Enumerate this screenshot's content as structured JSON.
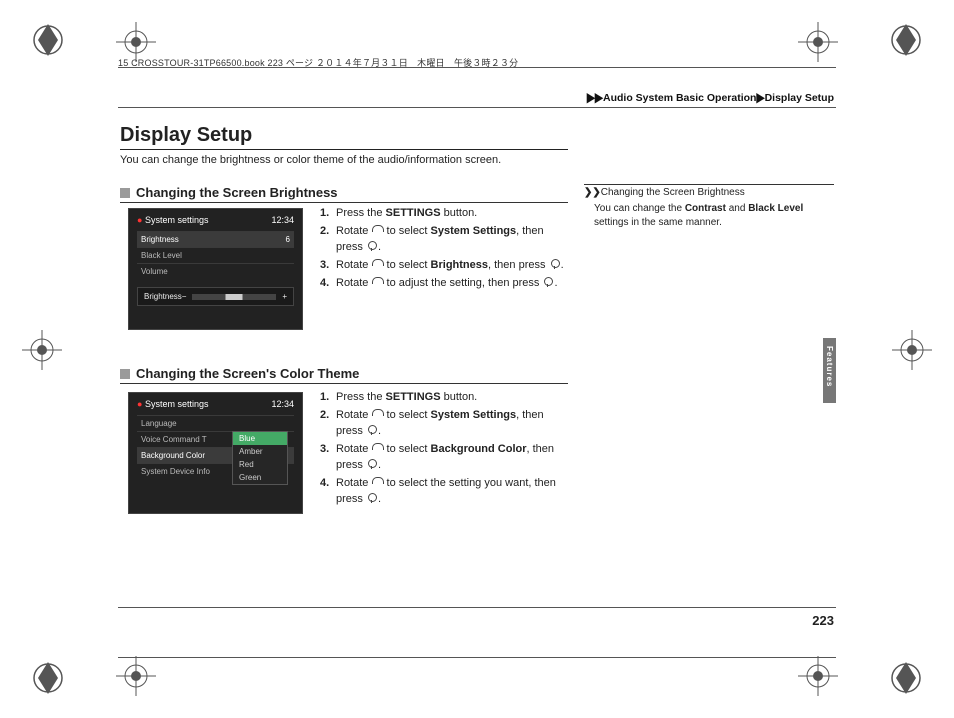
{
  "header_meta": "15 CROSSTOUR-31TP66500.book  223 ページ  ２０１４年７月３１日　木曜日　午後３時２３分",
  "breadcrumb": {
    "sep": "▶▶",
    "a": "Audio System Basic Operation",
    "b": "Display Setup"
  },
  "title": "Display Setup",
  "intro": "You can change the brightness or color theme of the audio/information screen.",
  "section1": {
    "heading": "Changing the Screen Brightness",
    "screenshot": {
      "panel": "System settings",
      "clock": "12:34",
      "rows": [
        {
          "label": "Brightness",
          "value": "6",
          "hi": true
        },
        {
          "label": "Black Level",
          "value": ""
        },
        {
          "label": "Volume",
          "value": ""
        }
      ],
      "footer_label": "Brightness",
      "minus": "−",
      "plus": "+"
    },
    "steps": [
      {
        "n": "1.",
        "pre": "Press the ",
        "bold": "SETTINGS",
        "post": " button."
      },
      {
        "n": "2.",
        "pre": "Rotate ",
        "icon1": "dial",
        "mid": " to select ",
        "bold": "System Settings",
        "post2": ", then press ",
        "icon2": "press",
        "tail": "."
      },
      {
        "n": "3.",
        "pre": "Rotate ",
        "icon1": "dial",
        "mid": " to select ",
        "bold": "Brightness",
        "post2": ", then press ",
        "icon2": "press",
        "tail": "."
      },
      {
        "n": "4.",
        "pre": "Rotate ",
        "icon1": "dial",
        "mid": " to adjust the setting, then press ",
        "icon2": "press",
        "tail": "."
      }
    ]
  },
  "section2": {
    "heading": "Changing the Screen's Color Theme",
    "screenshot": {
      "panel": "System settings",
      "clock": "12:34",
      "rows": [
        {
          "label": "Language",
          "value": ""
        },
        {
          "label": "Voice Command T",
          "value": ""
        },
        {
          "label": "Background Color",
          "value": "",
          "hi": true
        },
        {
          "label": "System Device Info",
          "value": ""
        }
      ],
      "options": [
        "Blue",
        "Amber",
        "Red",
        "Green"
      ],
      "selected": "Blue"
    },
    "steps": [
      {
        "n": "1.",
        "pre": "Press the ",
        "bold": "SETTINGS",
        "post": " button."
      },
      {
        "n": "2.",
        "pre": "Rotate ",
        "icon1": "dial",
        "mid": " to select ",
        "bold": "System Settings",
        "post2": ", then press ",
        "icon2": "press",
        "tail": "."
      },
      {
        "n": "3.",
        "pre": "Rotate ",
        "icon1": "dial",
        "mid": " to select ",
        "bold": "Background Color",
        "post2": ", then press ",
        "icon2": "press",
        "tail": "."
      },
      {
        "n": "4.",
        "pre": "Rotate ",
        "icon1": "dial",
        "mid": " to select the setting you want, then press ",
        "icon2": "press",
        "tail": "."
      }
    ]
  },
  "sidenote": {
    "heading": "Changing the Screen Brightness",
    "body_pre": "You can change the ",
    "b1": "Contrast",
    "mid": " and ",
    "b2": "Black Level",
    "body_post": " settings in the same manner."
  },
  "side_tab": "Features",
  "page_number": "223"
}
